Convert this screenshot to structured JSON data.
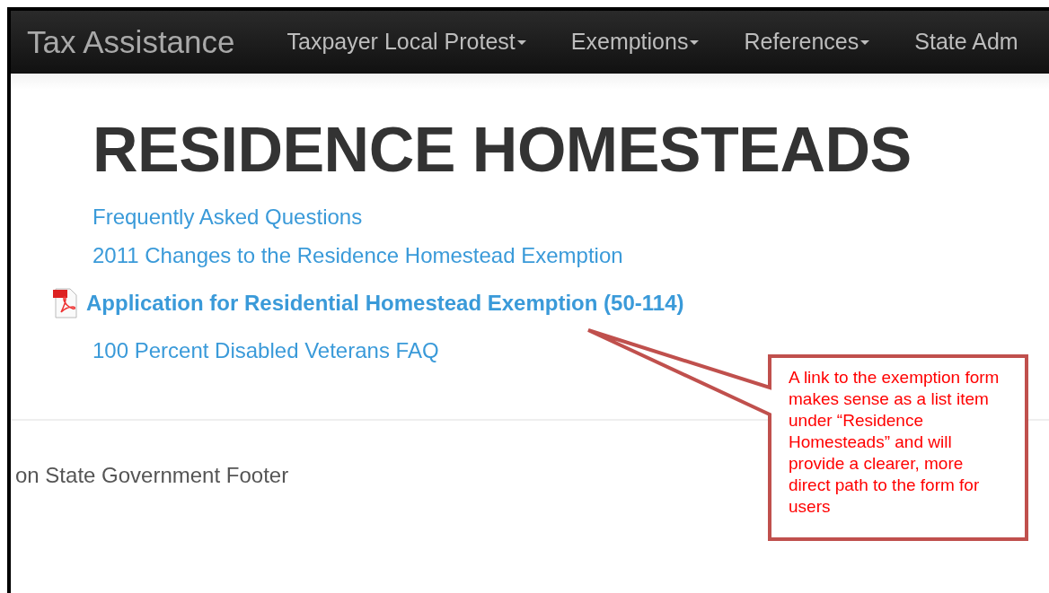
{
  "navbar": {
    "brand": "Tax Assistance",
    "items": [
      {
        "label": "Taxpayer Local Protest",
        "dropdown": true
      },
      {
        "label": "Exemptions",
        "dropdown": true
      },
      {
        "label": "References",
        "dropdown": true
      },
      {
        "label": "State Adm",
        "dropdown": false
      }
    ]
  },
  "heading": "RESIDENCE HOMESTEADS",
  "links": [
    {
      "label": "Frequently Asked Questions",
      "kind": "link"
    },
    {
      "label": "2011 Changes to the Residence Homestead Exemption",
      "kind": "link"
    },
    {
      "label": "Application for Residential Homestead Exemption (50-114)",
      "kind": "pdf"
    },
    {
      "label": "100 Percent Disabled Veterans FAQ",
      "kind": "link"
    }
  ],
  "footer": {
    "text": "on State Government Footer"
  },
  "callout": {
    "text": "A link to the exemption form makes sense as a list item under “Residence Homesteads” and will provide a clearer, more direct path to the form for users"
  }
}
